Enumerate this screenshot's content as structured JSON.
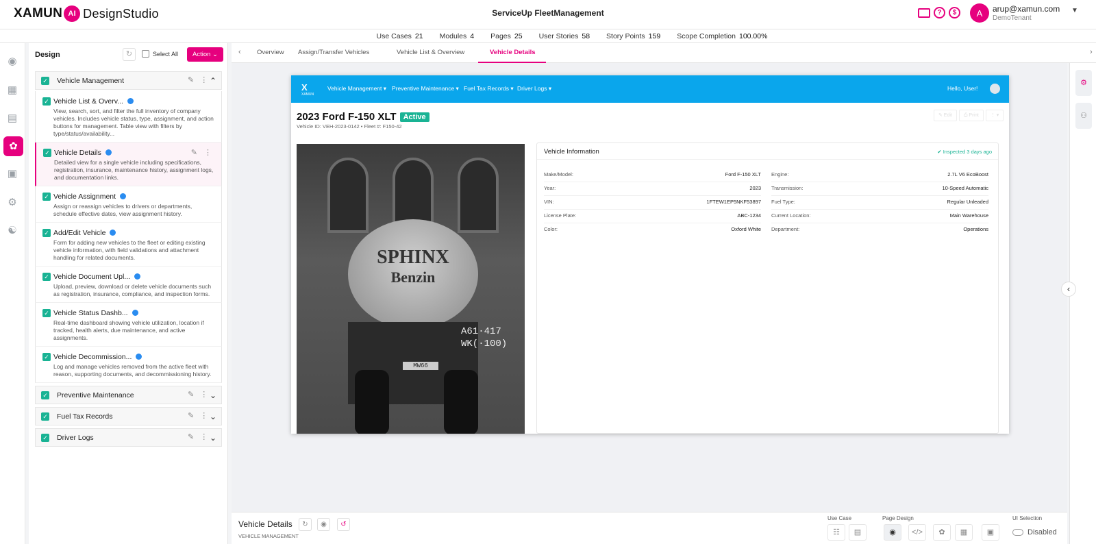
{
  "header": {
    "logo_left": "XAMUN",
    "logo_ai": "AI",
    "logo_right": "DesignStudio",
    "app_title": "ServiceUp FleetManagement",
    "user_initial": "A",
    "user_email": "arup@xamun.com",
    "user_tenant": "DemoTenant",
    "icons": [
      "monitor-icon",
      "help-icon",
      "dollar-icon"
    ],
    "accent_color": "#e6007e"
  },
  "stats": [
    {
      "label": "Use Cases",
      "value": "21"
    },
    {
      "label": "Modules",
      "value": "4"
    },
    {
      "label": "Pages",
      "value": "25"
    },
    {
      "label": "User Stories",
      "value": "58"
    },
    {
      "label": "Story Points",
      "value": "159"
    },
    {
      "label": "Scope Completion",
      "value": "100.00%"
    }
  ],
  "leftnav": [
    "chat-icon",
    "building-icon",
    "document-icon",
    "palette-icon",
    "calendar-icon",
    "gear-icon",
    "handshake-icon"
  ],
  "design_panel": {
    "title": "Design",
    "select_all": "Select All",
    "action": "Action",
    "groups": [
      {
        "label": "Vehicle Management",
        "expanded": true
      },
      {
        "label": "Preventive Maintenance",
        "expanded": false
      },
      {
        "label": "Fuel Tax Records",
        "expanded": false
      },
      {
        "label": "Driver Logs",
        "expanded": false
      }
    ],
    "items": [
      {
        "title": "Vehicle List & Overv...",
        "desc": "View, search, sort, and filter the full inventory of company vehicles. Includes vehicle status, type, assignment, and action buttons for management. Table view with filters by type/status/availability..."
      },
      {
        "title": "Vehicle Details",
        "desc": "Detailed view for a single vehicle including specifications, registration, insurance, maintenance history, assignment logs, and documentation links."
      },
      {
        "title": "Vehicle Assignment",
        "desc": "Assign or reassign vehicles to drivers or departments, schedule effective dates, view assignment history."
      },
      {
        "title": "Add/Edit Vehicle",
        "desc": "Form for adding new vehicles to the fleet or editing existing vehicle information, with field validations and attachment handling for related documents."
      },
      {
        "title": "Vehicle Document Upl...",
        "desc": "Upload, preview, download or delete vehicle documents such as registration, insurance, compliance, and inspection forms."
      },
      {
        "title": "Vehicle Status Dashb...",
        "desc": "Real-time dashboard showing vehicle utilization, location if tracked, health alerts, due maintenance, and active assignments."
      },
      {
        "title": "Vehicle Decommission...",
        "desc": "Log and manage vehicles removed from the active fleet with reason, supporting documents, and decommissioning history."
      }
    ]
  },
  "tabs": [
    "Overview",
    "Assign/Transfer Vehicles",
    "Vehicle List & Overview",
    "Vehicle Details"
  ],
  "preview": {
    "logo": "X",
    "logo_sub": "XAMUN",
    "menu": [
      "Vehicle Management ▾",
      "Preventive Maintenance ▾",
      "Fuel Tax Records ▾",
      "Driver Logs ▾"
    ],
    "hello": "Hello, User!",
    "vehicle_title": "2023 Ford F-150 XLT",
    "status": "Active",
    "subtitle": "Vehicle ID: VEH-2023-0142 • Fleet #: F150-42",
    "buttons": [
      "✎ Edit",
      "⎙ Print",
      "⋮ ▾"
    ],
    "photo_text_1": "SPHINX",
    "photo_text_2": "Benzin",
    "photo_plate_1": "A61·417",
    "photo_plate_2": "WK(·100)",
    "photo_plate_3": "MW66",
    "info_title": "Vehicle Information",
    "inspected": "Inspected 3 days ago",
    "info_left": [
      {
        "k": "Make/Model:",
        "v": "Ford F-150 XLT"
      },
      {
        "k": "Year:",
        "v": "2023"
      },
      {
        "k": "VIN:",
        "v": "1FTEW1EP5NKF53897"
      },
      {
        "k": "License Plate:",
        "v": "ABC-1234"
      },
      {
        "k": "Color:",
        "v": "Oxford White"
      }
    ],
    "info_right": [
      {
        "k": "Engine:",
        "v": "2.7L V6 EcoBoost"
      },
      {
        "k": "Transmission:",
        "v": "10-Speed Automatic"
      },
      {
        "k": "Fuel Type:",
        "v": "Regular Unleaded"
      },
      {
        "k": "Current Location:",
        "v": "Main Warehouse"
      },
      {
        "k": "Department:",
        "v": "Operations"
      }
    ]
  },
  "bottom": {
    "title": "Vehicle Details",
    "subtitle": "VEHICLE MANAGEMENT",
    "use_case_label": "Use Case",
    "page_design_label": "Page Design",
    "ui_selection_label": "UI Selection",
    "ui_selection_value": "Disabled"
  }
}
